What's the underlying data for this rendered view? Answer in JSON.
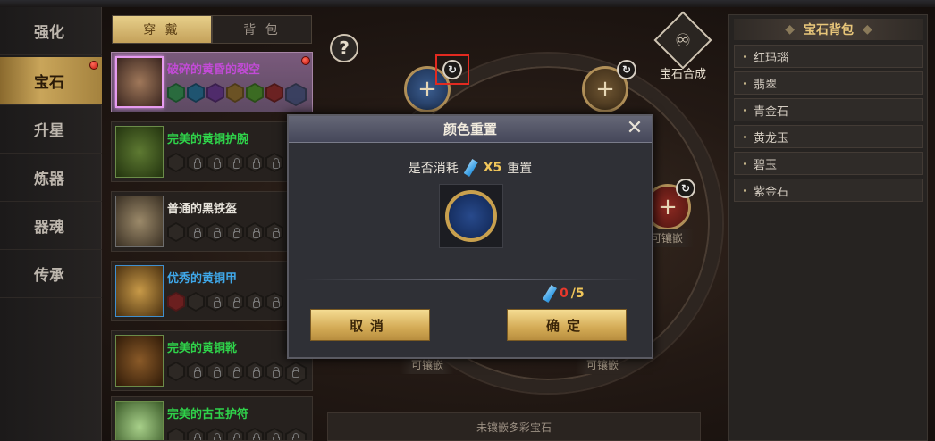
{
  "nav": {
    "items": [
      {
        "label": "强化"
      },
      {
        "label": "宝石"
      },
      {
        "label": "升星"
      },
      {
        "label": "炼器"
      },
      {
        "label": "器魂"
      },
      {
        "label": "传承"
      }
    ],
    "active_index": 1
  },
  "equip_tabs": {
    "wear": "穿 戴",
    "bag": "背 包"
  },
  "equipment": [
    {
      "name": "破碎的黄昏的裂空",
      "color": "#c24bd6"
    },
    {
      "name": "完美的黄铜护腕",
      "color": "#2fd24a"
    },
    {
      "name": "普通的黑铁盔",
      "color": "#e6e2da"
    },
    {
      "name": "优秀的黄铜甲",
      "color": "#3fa7e8"
    },
    {
      "name": "完美的黄铜靴",
      "color": "#2fd24a"
    },
    {
      "name": "完美的古玉护符",
      "color": "#2fd24a"
    }
  ],
  "board": {
    "socket_caption_right": "可镶嵌",
    "socket_caption_bl": "可镶嵌",
    "socket_caption_br": "可镶嵌",
    "bottom_hint": "未镶嵌多彩宝石",
    "synth_label": "宝石合成"
  },
  "gem_bag": {
    "title": "宝石背包",
    "items": [
      "红玛瑙",
      "翡翠",
      "青金石",
      "黄龙玉",
      "碧玉",
      "紫金石"
    ]
  },
  "modal": {
    "title": "颜色重置",
    "question_prefix": "是否消耗",
    "cost": "X5",
    "question_suffix": "重置",
    "have": "0",
    "need": "/5",
    "cancel": "取消",
    "confirm": "确定"
  },
  "colors": {
    "accent_gold": "#c9a55a",
    "highlight_red": "#e22a20",
    "gem_blue": "#284a8c"
  }
}
